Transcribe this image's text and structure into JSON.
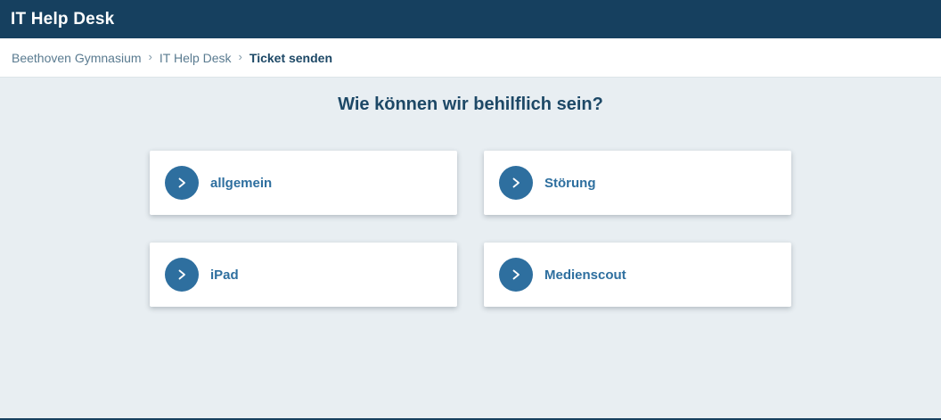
{
  "header": {
    "title": "IT Help Desk"
  },
  "breadcrumb": {
    "separator": "›",
    "items": [
      {
        "label": "Beethoven Gymnasium",
        "current": false
      },
      {
        "label": "IT Help Desk",
        "current": false
      },
      {
        "label": "Ticket senden",
        "current": true
      }
    ]
  },
  "main": {
    "heading": "Wie können wir behilflich sein?",
    "categories": [
      {
        "label": "allgemein"
      },
      {
        "label": "Störung"
      },
      {
        "label": "iPad"
      },
      {
        "label": "Medienscout"
      }
    ]
  },
  "icons": {
    "category_arrow": "chevron-right-icon",
    "breadcrumb_separator": "chevron-right"
  },
  "colors": {
    "header_bg": "#16405f",
    "accent_blue": "#2e6f9f",
    "heading_text": "#1d4866",
    "breadcrumb_link": "#5a7b90",
    "page_bg": "#e8eef2",
    "card_bg": "#ffffff"
  }
}
